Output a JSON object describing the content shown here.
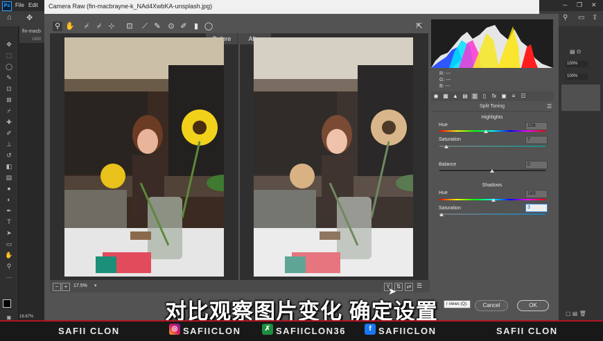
{
  "ps_menu": {
    "logo": "Ps",
    "items": [
      "File",
      "Edit"
    ]
  },
  "ps_tab": {
    "label": "fin-macb"
  },
  "ps_ruler": {
    "value": "1800"
  },
  "ps_status": {
    "zoom": "16.67%"
  },
  "ps_right": {
    "zoom1": "100%",
    "zoom2": "100%"
  },
  "dialog": {
    "title": "Camera Raw (fin-macbrayne-k_NAd4XwbKA-unsplash.jpg)"
  },
  "preview": {
    "before_label": "Before",
    "after_label": "After",
    "zoom": "17.5%"
  },
  "readout": {
    "r": "R:   ---",
    "g": "G:   ---",
    "b": "B:   ---"
  },
  "panel": {
    "title": "Split Toning",
    "highlights": {
      "header": "Highlights",
      "hue_label": "Hue",
      "hue_value": "158",
      "sat_label": "Saturation",
      "sat_value": "7"
    },
    "balance": {
      "label": "Balance",
      "value": "0"
    },
    "shadows": {
      "header": "Shadows",
      "hue_label": "Hue",
      "hue_value": "183",
      "sat_label": "Saturation",
      "sat_value": "3"
    }
  },
  "tooltip": "r views (Q).",
  "buttons": {
    "cancel": "Cancel",
    "ok": "OK"
  },
  "caption": "对比观察图片变化 确定设置",
  "footer": {
    "left": "SAFII CLON",
    "insta": "SAFIICLON",
    "gamepad": "SAFIICLON36",
    "facebook": "SAFIICLON",
    "right": "SAFII CLON"
  },
  "colors": {
    "accent": "#b01523",
    "panel": "#535353",
    "focus": "#3b86d9"
  }
}
